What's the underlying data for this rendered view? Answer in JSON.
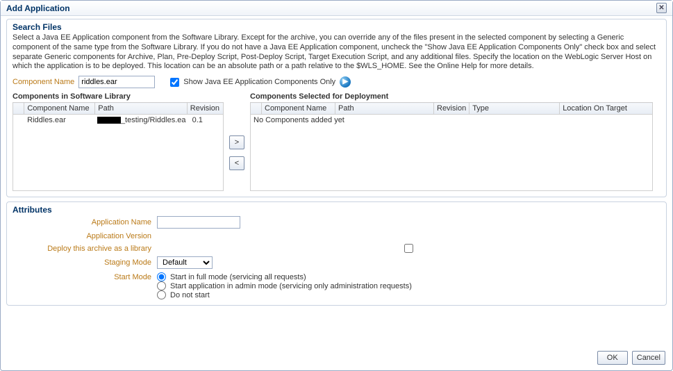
{
  "dialog": {
    "title": "Add Application"
  },
  "search": {
    "title": "Search Files",
    "help": "Select a Java EE Application component from the Software Library. Except for the archive, you can override any of the files present in the selected component by selecting a Generic component of the same type from the Software Library. If you do not have a Java EE Application component, uncheck the \"Show Java EE Application Components Only\" check box and select separate Generic components for Archive, Plan, Pre-Deploy Script, Post-Deploy Script, Target Execution Script, and any additional files. Specify the location on the WebLogic Server Host on which the application is to be deployed. This location can be an absolute path or a path relative to the $WLS_HOME. See the Online Help for more details.",
    "componentName_label": "Component Name",
    "componentName_value": "riddles.ear",
    "showOnly_label": "Show Java EE Application Components Only"
  },
  "libTable": {
    "title": "Components in Software Library",
    "cols": {
      "name": "Component Name",
      "path": "Path",
      "rev": "Revision"
    },
    "row": {
      "name": "Riddles.ear",
      "pathTail": "_testing/Riddles.ea",
      "rev": "0.1"
    }
  },
  "depTable": {
    "title": "Components Selected for Deployment",
    "cols": {
      "name": "Component Name",
      "path": "Path",
      "rev": "Revision",
      "type": "Type",
      "loc": "Location On Target"
    },
    "empty": "No Components added yet"
  },
  "move": {
    "right": ">",
    "left": "<"
  },
  "attrs": {
    "title": "Attributes",
    "appName_label": "Application Name",
    "appName_value": "",
    "appVersion_label": "Application Version",
    "deployLib_label": "Deploy this archive as a library",
    "stagingMode_label": "Staging Mode",
    "stagingMode_value": "Default",
    "startMode_label": "Start Mode",
    "startMode_full": "Start in full mode (servicing all requests)",
    "startMode_admin": "Start application in admin mode (servicing only administration requests)",
    "startMode_none": "Do not start"
  },
  "footer": {
    "ok": "OK",
    "cancel": "Cancel"
  }
}
